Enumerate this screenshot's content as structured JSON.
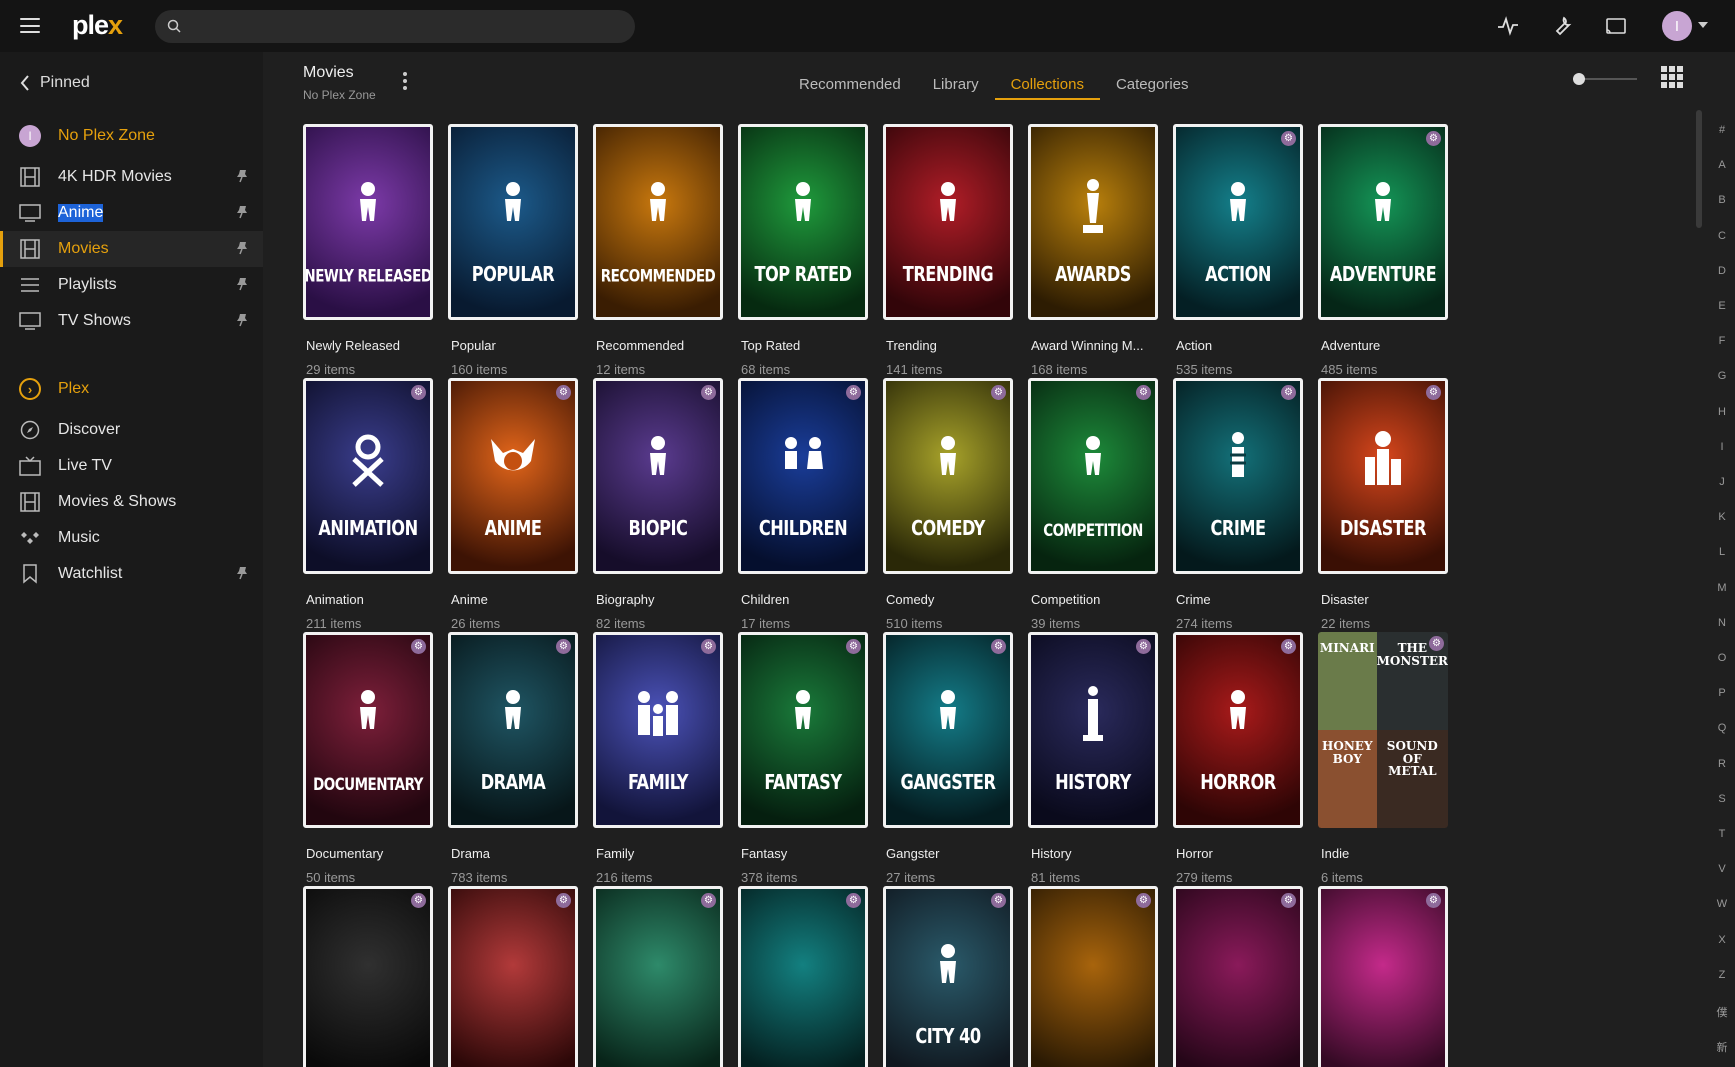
{
  "app": {
    "logo_text": "ple",
    "logo_x": "x",
    "brand_color": "#e5a00d"
  },
  "top": {
    "search_placeholder": "",
    "user_initial": "I"
  },
  "sidebar": {
    "pinned_label": "Pinned",
    "items": [
      {
        "label": "No Plex Zone",
        "icon": "avatar-icon",
        "pinned": false
      },
      {
        "label": "4K HDR Movies",
        "icon": "film-icon",
        "pinned": true
      },
      {
        "label": "Anime",
        "icon": "tv-icon",
        "pinned": true
      },
      {
        "label": "Movies",
        "icon": "film-icon",
        "pinned": true
      },
      {
        "label": "Playlists",
        "icon": "list-icon",
        "pinned": true
      },
      {
        "label": "TV Shows",
        "icon": "tv-icon",
        "pinned": true
      },
      {
        "label": "Plex",
        "icon": "plex-chevron-icon",
        "pinned": false
      },
      {
        "label": "Discover",
        "icon": "compass-icon",
        "pinned": false
      },
      {
        "label": "Live TV",
        "icon": "live-tv-icon",
        "pinned": false
      },
      {
        "label": "Movies & Shows",
        "icon": "film-icon",
        "pinned": false
      },
      {
        "label": "Music",
        "icon": "music-icon",
        "pinned": false
      },
      {
        "label": "Watchlist",
        "icon": "bookmark-icon",
        "pinned": true
      }
    ]
  },
  "header": {
    "title": "Movies",
    "subtitle": "No Plex Zone",
    "tabs": [
      "Recommended",
      "Library",
      "Collections",
      "Categories"
    ],
    "active_tab": "Collections"
  },
  "collections": [
    {
      "poster": "NEWLY RELEASED",
      "title": "Newly Released",
      "count": "29 items",
      "c1": "#7c3aa8",
      "c2": "#2a0f45"
    },
    {
      "poster": "POPULAR",
      "title": "Popular",
      "count": "160 items",
      "c1": "#1c5a8a",
      "c2": "#081a30"
    },
    {
      "poster": "RECOMMENDED",
      "title": "Recommended",
      "count": "12 items",
      "c1": "#c8780e",
      "c2": "#3a1d02"
    },
    {
      "poster": "TOP RATED",
      "title": "Top Rated",
      "count": "68 items",
      "c1": "#1f9a3c",
      "c2": "#062a10"
    },
    {
      "poster": "TRENDING",
      "title": "Trending",
      "count": "141 items",
      "c1": "#b01d27",
      "c2": "#320509"
    },
    {
      "poster": "AWARDS",
      "title": "Award Winning M...",
      "count": "168 items",
      "c1": "#b9800c",
      "c2": "#2d1c02"
    },
    {
      "poster": "ACTION",
      "title": "Action",
      "count": "535 items",
      "c1": "#147f8a",
      "c2": "#041f24"
    },
    {
      "poster": "ADVENTURE",
      "title": "Adventure",
      "count": "485 items",
      "c1": "#149456",
      "c2": "#052617"
    },
    {
      "poster": "ANIMATION",
      "title": "Animation",
      "count": "211 items",
      "c1": "#3a3d8c",
      "c2": "#0d0e28"
    },
    {
      "poster": "ANIME",
      "title": "Anime",
      "count": "26 items",
      "c1": "#e2651a",
      "c2": "#3d1304"
    },
    {
      "poster": "BIOPIC",
      "title": "Biography",
      "count": "82 items",
      "c1": "#5a3b8f",
      "c2": "#160d2a"
    },
    {
      "poster": "CHILDREN",
      "title": "Children",
      "count": "17 items",
      "c1": "#1a3d99",
      "c2": "#050f2e"
    },
    {
      "poster": "COMEDY",
      "title": "Comedy",
      "count": "510 items",
      "c1": "#a7a22a",
      "c2": "#2a2807"
    },
    {
      "poster": "COMPETITION",
      "title": "Competition",
      "count": "39 items",
      "c1": "#1d8a3a",
      "c2": "#06240f"
    },
    {
      "poster": "CRIME",
      "title": "Crime",
      "count": "274 items",
      "c1": "#137078",
      "c2": "#04191c"
    },
    {
      "poster": "DISASTER",
      "title": "Disaster",
      "count": "22 items",
      "c1": "#d6461c",
      "c2": "#3a0f04"
    },
    {
      "poster": "DOCUMENTARY",
      "title": "Documentary",
      "count": "50 items",
      "c1": "#7d1f3a",
      "c2": "#22060f"
    },
    {
      "poster": "DRAMA",
      "title": "Drama",
      "count": "783 items",
      "c1": "#1f5563",
      "c2": "#071619"
    },
    {
      "poster": "FAMILY",
      "title": "Family",
      "count": "216 items",
      "c1": "#4b52b8",
      "c2": "#12143a"
    },
    {
      "poster": "FANTASY",
      "title": "Fantasy",
      "count": "378 items",
      "c1": "#1a7a3a",
      "c2": "#051f0f"
    },
    {
      "poster": "GANGSTER",
      "title": "Gangster",
      "count": "27 items",
      "c1": "#147c88",
      "c2": "#041c20"
    },
    {
      "poster": "HISTORY",
      "title": "History",
      "count": "81 items",
      "c1": "#2a2a5c",
      "c2": "#0a0a1c"
    },
    {
      "poster": "HORROR",
      "title": "Horror",
      "count": "279 items",
      "c1": "#a81a1a",
      "c2": "#2e0505"
    },
    {
      "poster": "INDIE",
      "title": "Indie",
      "count": "6 items",
      "c1": "#000",
      "c2": "#000"
    },
    {
      "poster": "",
      "title": "",
      "count": "",
      "c1": "#303030",
      "c2": "#0a0a0a"
    },
    {
      "poster": "",
      "title": "",
      "count": "",
      "c1": "#b23a3a",
      "c2": "#2d0808"
    },
    {
      "poster": "",
      "title": "",
      "count": "",
      "c1": "#2e8a6a",
      "c2": "#082419"
    },
    {
      "poster": "",
      "title": "",
      "count": "",
      "c1": "#138080",
      "c2": "#042020"
    },
    {
      "poster": "CITY 40",
      "title": "",
      "count": "",
      "c1": "#2a5a6a",
      "c2": "#101820"
    },
    {
      "poster": "",
      "title": "",
      "count": "",
      "c1": "#a8640c",
      "c2": "#2b1a03"
    },
    {
      "poster": "",
      "title": "",
      "count": "",
      "c1": "#8a1a5a",
      "c2": "#250618"
    },
    {
      "poster": "",
      "title": "",
      "count": "",
      "c1": "#c42a8a",
      "c2": "#340a24"
    }
  ],
  "indie_tiles": [
    "MINARI",
    "THE MONSTER",
    "HONEY BOY",
    "SOUND OF METAL"
  ],
  "alphabet": [
    "#",
    "A",
    "B",
    "C",
    "D",
    "E",
    "F",
    "G",
    "H",
    "I",
    "J",
    "K",
    "L",
    "M",
    "N",
    "O",
    "P",
    "Q",
    "R",
    "S",
    "T",
    "V",
    "W",
    "X",
    "Z",
    "僕",
    "新"
  ]
}
